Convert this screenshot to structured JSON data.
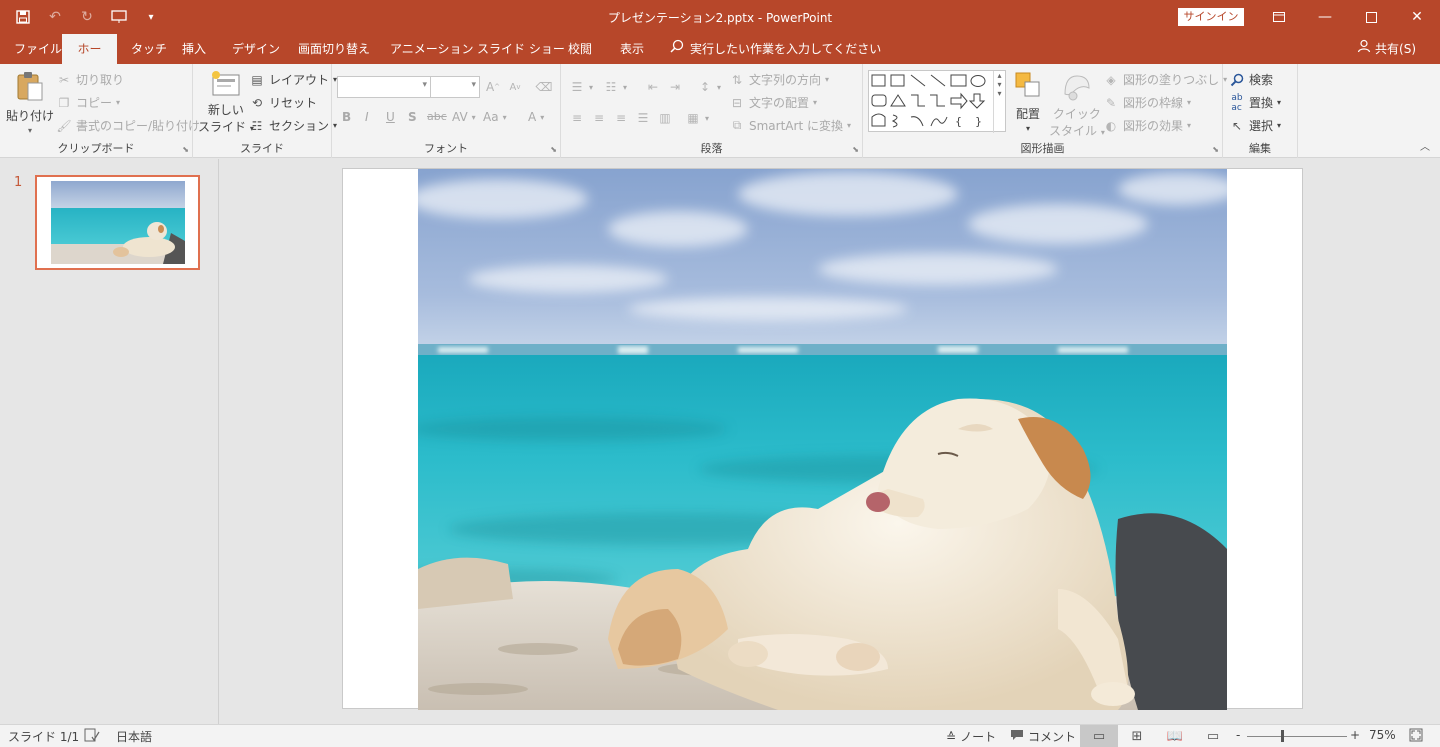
{
  "window": {
    "title": "プレゼンテーション2.pptx  -  PowerPoint",
    "signin_label": "サインイン"
  },
  "tabs": [
    {
      "label": "ファイル"
    },
    {
      "label": "ホーム"
    },
    {
      "label": "タッチ"
    },
    {
      "label": "挿入"
    },
    {
      "label": "デザイン"
    },
    {
      "label": "画面切り替え"
    },
    {
      "label": "アニメーション"
    },
    {
      "label": "スライド ショー"
    },
    {
      "label": "校閲"
    },
    {
      "label": "表示"
    }
  ],
  "tell_me": "実行したい作業を入力してください",
  "share_label": "共有(S)",
  "ribbon": {
    "clipboard": {
      "label": "クリップボード",
      "paste": "貼り付け",
      "cut": "切り取り",
      "copy": "コピー",
      "format_painter": "書式のコピー/貼り付け"
    },
    "slides": {
      "label": "スライド",
      "new_slide_1": "新しい",
      "new_slide_2": "スライド",
      "layout": "レイアウト",
      "reset": "リセット",
      "section": "セクション"
    },
    "font": {
      "label": "フォント",
      "bold": "B",
      "italic": "I",
      "underline": "U",
      "shadow": "S",
      "strike": "abc",
      "spacing": "AV",
      "case": "Aa",
      "color": "A"
    },
    "paragraph": {
      "label": "段落",
      "text_direction": "文字列の方向",
      "align_text": "文字の配置",
      "smartart": "SmartArt に変換"
    },
    "drawing": {
      "label": "図形描画",
      "arrange": "配置",
      "quick_styles_1": "クイック",
      "quick_styles_2": "スタイル",
      "fill": "図形の塗りつぶし",
      "outline": "図形の枠線",
      "effects": "図形の効果"
    },
    "editing": {
      "label": "編集",
      "find": "検索",
      "replace": "置換",
      "select": "選択"
    }
  },
  "slides_panel": {
    "slide_number": "1"
  },
  "status": {
    "slide_count": "スライド 1/1",
    "language": "日本語",
    "notes": "ノート",
    "comments": "コメント",
    "zoom_minus": "-",
    "zoom_plus": "+",
    "zoom_level": "75%"
  }
}
